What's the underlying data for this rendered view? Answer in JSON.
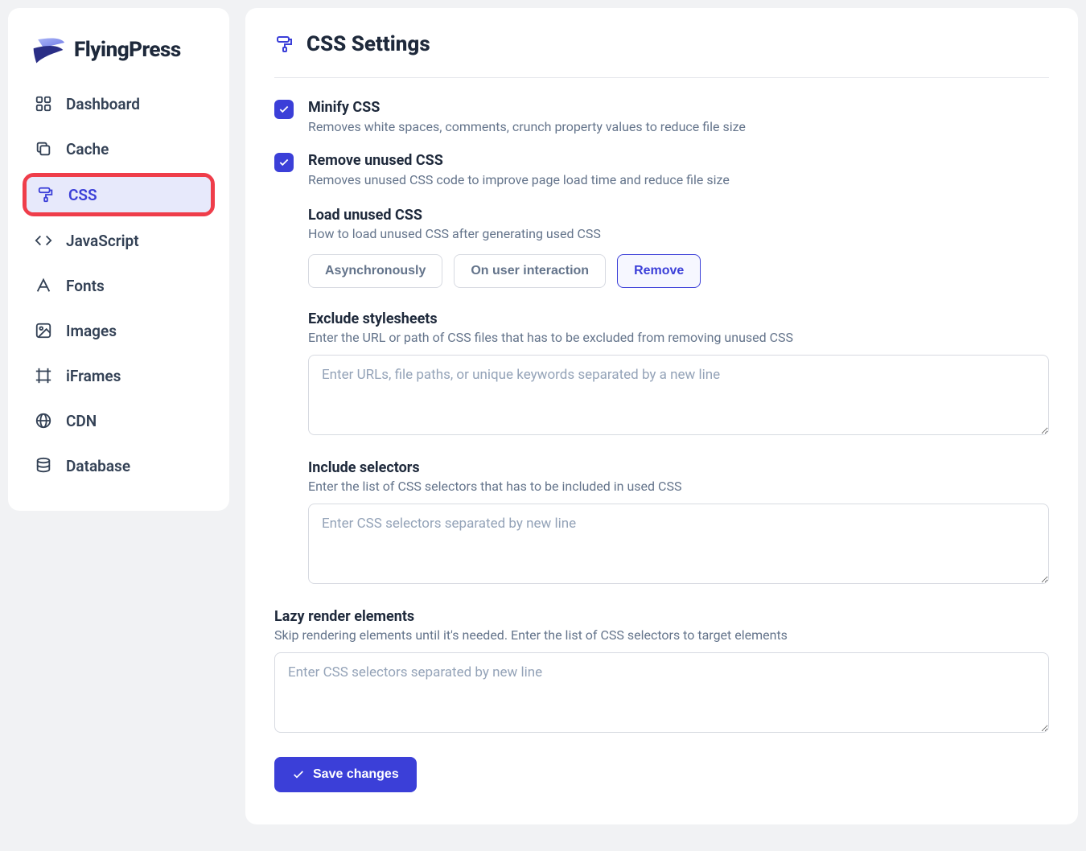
{
  "brand": {
    "name": "FlyingPress"
  },
  "sidebar": {
    "items": [
      {
        "id": "dashboard",
        "label": "Dashboard"
      },
      {
        "id": "cache",
        "label": "Cache"
      },
      {
        "id": "css",
        "label": "CSS"
      },
      {
        "id": "javascript",
        "label": "JavaScript"
      },
      {
        "id": "fonts",
        "label": "Fonts"
      },
      {
        "id": "images",
        "label": "Images"
      },
      {
        "id": "iframes",
        "label": "iFrames"
      },
      {
        "id": "cdn",
        "label": "CDN"
      },
      {
        "id": "database",
        "label": "Database"
      }
    ],
    "active": "css",
    "highlighted": "css"
  },
  "page": {
    "title": "CSS Settings"
  },
  "settings": {
    "minify": {
      "label": "Minify CSS",
      "description": "Removes white spaces, comments, crunch property values to reduce file size",
      "checked": true
    },
    "remove_unused": {
      "label": "Remove unused CSS",
      "description": "Removes unused CSS code to improve page load time and reduce file size",
      "checked": true
    },
    "load_unused": {
      "label": "Load unused CSS",
      "description": "How to load unused CSS after generating used CSS",
      "options": [
        "Asynchronously",
        "On user interaction",
        "Remove"
      ],
      "selected": "Remove"
    },
    "exclude_stylesheets": {
      "label": "Exclude stylesheets",
      "description": "Enter the URL or path of CSS files that has to be excluded from removing unused CSS",
      "placeholder": "Enter URLs, file paths, or unique keywords separated by a new line",
      "value": ""
    },
    "include_selectors": {
      "label": "Include selectors",
      "description": "Enter the list of CSS selectors that has to be included in used CSS",
      "placeholder": "Enter CSS selectors separated by new line",
      "value": ""
    },
    "lazy_render": {
      "label": "Lazy render elements",
      "description": "Skip rendering elements until it's needed. Enter the list of CSS selectors to target elements",
      "placeholder": "Enter CSS selectors separated by new line",
      "value": ""
    }
  },
  "actions": {
    "save": "Save changes"
  }
}
